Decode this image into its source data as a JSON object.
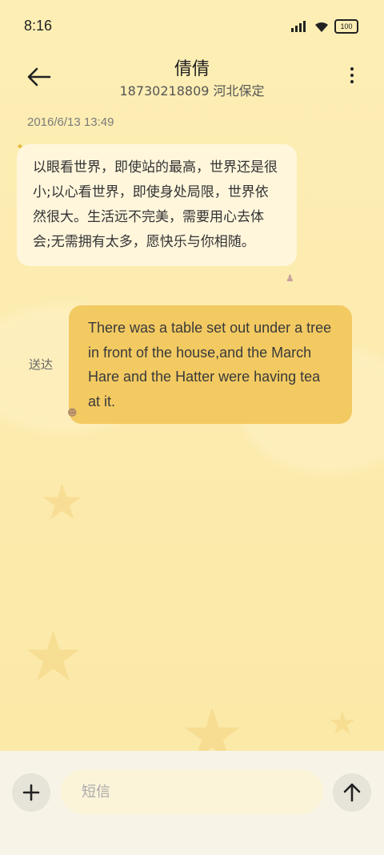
{
  "status_bar": {
    "time": "8:16",
    "battery": "100"
  },
  "header": {
    "contact_name": "倩倩",
    "contact_detail": "18730218809 河北保定"
  },
  "conversation": {
    "timestamp": "2016/6/13 13:49",
    "incoming_message": "以眼看世界，即使站的最高，世界还是很小;以心看世界，即使身处局限，世界依然很大。生活远不完美，需要用心去体会;无需拥有太多，愿快乐与你相随。",
    "outgoing_message": "There was a table set out under a tree in front of the house,and the March Hare and the Hatter were having tea at it.",
    "outgoing_status": "送达"
  },
  "composer": {
    "placeholder": "短信"
  },
  "colors": {
    "background": "#fcecae",
    "incoming_bubble": "#fff6dc",
    "outgoing_bubble": "#f3ca62",
    "bottom_bar": "#f7f3e6"
  },
  "icons": [
    "back-arrow-icon",
    "more-vertical-icon",
    "plus-icon",
    "send-arrow-icon",
    "wifi-icon",
    "signal-icon",
    "battery-icon"
  ]
}
